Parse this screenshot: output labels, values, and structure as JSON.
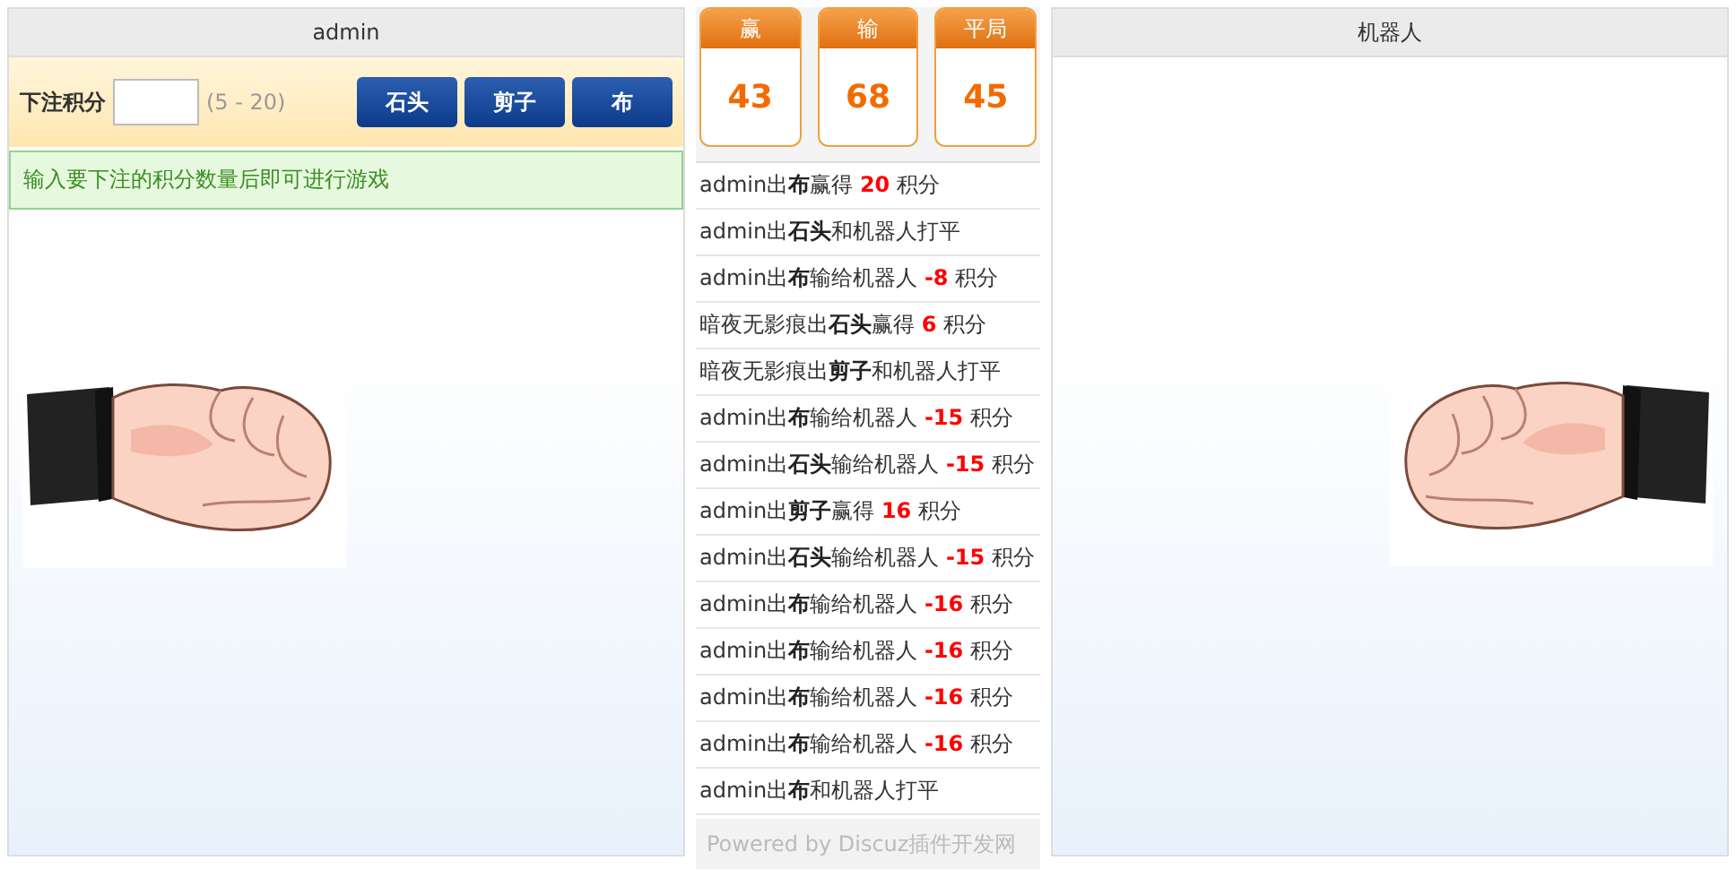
{
  "player_panel": {
    "title": "admin",
    "bet_label": "下注积分",
    "bet_range": "(5 - 20)",
    "move_buttons": [
      "石头",
      "剪子",
      "布"
    ],
    "hint": "输入要下注的积分数量后即可进行游戏"
  },
  "stats": [
    {
      "label": "赢",
      "value": "43"
    },
    {
      "label": "输",
      "value": "68"
    },
    {
      "label": "平局",
      "value": "45"
    }
  ],
  "log": [
    {
      "before": "admin出",
      "move": "布",
      "after": "赢得 ",
      "points": "20",
      "unit": " 积分"
    },
    {
      "before": "admin出",
      "move": "石头",
      "after": "和机器人打平"
    },
    {
      "before": "admin出",
      "move": "布",
      "after": "输给机器人 ",
      "points": "-8",
      "unit": " 积分"
    },
    {
      "before": "暗夜无影痕出",
      "move": "石头",
      "after": "赢得 ",
      "points": "6",
      "unit": " 积分"
    },
    {
      "before": "暗夜无影痕出",
      "move": "剪子",
      "after": "和机器人打平"
    },
    {
      "before": "admin出",
      "move": "布",
      "after": "输给机器人 ",
      "points": "-15",
      "unit": " 积分"
    },
    {
      "before": "admin出",
      "move": "石头",
      "after": "输给机器人 ",
      "points": "-15",
      "unit": " 积分"
    },
    {
      "before": "admin出",
      "move": "剪子",
      "after": "赢得 ",
      "points": "16",
      "unit": " 积分"
    },
    {
      "before": "admin出",
      "move": "石头",
      "after": "输给机器人 ",
      "points": "-15",
      "unit": " 积分"
    },
    {
      "before": "admin出",
      "move": "布",
      "after": "输给机器人 ",
      "points": "-16",
      "unit": " 积分"
    },
    {
      "before": "admin出",
      "move": "布",
      "after": "输给机器人 ",
      "points": "-16",
      "unit": " 积分"
    },
    {
      "before": "admin出",
      "move": "布",
      "after": "输给机器人 ",
      "points": "-16",
      "unit": " 积分"
    },
    {
      "before": "admin出",
      "move": "布",
      "after": "输给机器人 ",
      "points": "-16",
      "unit": " 积分"
    },
    {
      "before": "admin出",
      "move": "布",
      "after": "和机器人打平"
    }
  ],
  "footer": "Powered by Discuz插件开发网",
  "robot_panel": {
    "title": "机器人"
  }
}
